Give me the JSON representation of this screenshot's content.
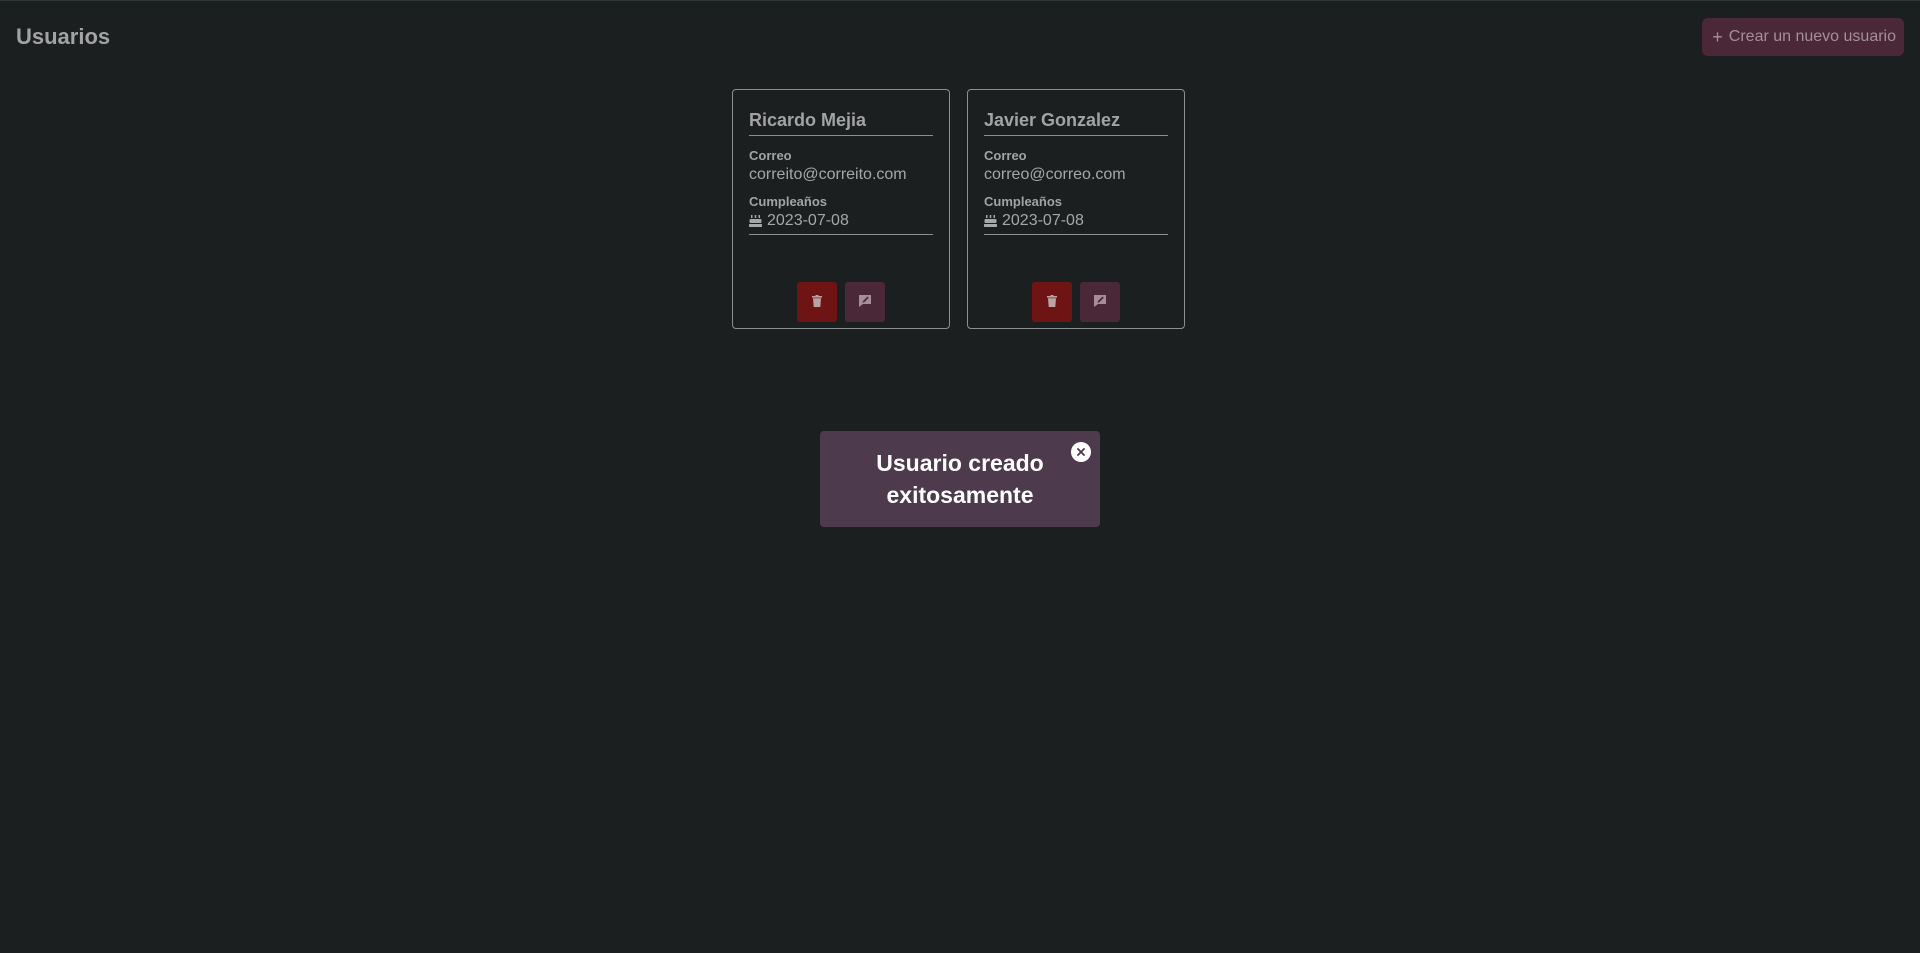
{
  "header": {
    "title": "Usuarios",
    "create_button_label": "Crear un nuevo usuario",
    "create_button_icon": "plus-icon"
  },
  "users": [
    {
      "name": "Ricardo Mejia",
      "email_label": "Correo",
      "email": "correito@correito.com",
      "birthday_label": "Cumpleaños",
      "birthday": "2023-07-08"
    },
    {
      "name": "Javier Gonzalez",
      "email_label": "Correo",
      "email": "correo@correo.com",
      "birthday_label": "Cumpleaños",
      "birthday": "2023-07-08"
    }
  ],
  "toast": {
    "message": "Usuario creado exitosamente"
  },
  "icons": {
    "birthday": "cake-icon",
    "delete": "trash-icon",
    "edit": "edit-icon",
    "close": "close-icon"
  },
  "colors": {
    "background": "#1b1f1f",
    "accent": "#4b2838",
    "danger": "#6e1414",
    "toast": "#4d3a4c"
  }
}
